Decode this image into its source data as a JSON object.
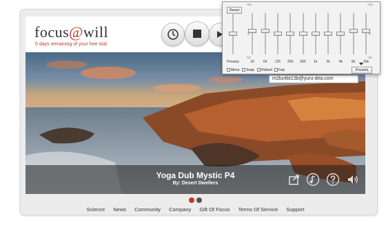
{
  "header": {
    "logo_text": "focus@will",
    "logo_part1": "focus",
    "logo_at": "@",
    "logo_part2": "will",
    "trial_notice": "5 days remaining of your free trial"
  },
  "player": {
    "track_title": "Yoga Dub Mystic P4",
    "artist_line": "By: Desert Dwellers",
    "controls": [
      "share-icon",
      "music-note-icon",
      "help-icon",
      "volume-icon"
    ],
    "top_buttons": [
      "timer-icon",
      "stop-icon",
      "next-icon"
    ]
  },
  "account": {
    "email_fragment": "m2bz4bt13b@yuru-dea.com"
  },
  "carousel": {
    "dot_colors": [
      "#c0392b",
      "#555555"
    ]
  },
  "footer": {
    "links": [
      "Science",
      "News",
      "Community",
      "Company",
      "Gift Of Focus",
      "Terms Of Service",
      "Support"
    ]
  },
  "equalizer": {
    "reset_label": "Reset",
    "scale_top": "+12",
    "scale_zero": "0",
    "scale_bottom": "-12",
    "bands": [
      {
        "label": "Preamp",
        "level": 0
      },
      {
        "label": "32",
        "level": 2
      },
      {
        "label": "64",
        "level": 2
      },
      {
        "label": "125",
        "level": 0
      },
      {
        "label": "250",
        "level": 0
      },
      {
        "label": "500",
        "level": 0
      },
      {
        "label": "1k",
        "level": 0
      },
      {
        "label": "2k",
        "level": 0
      },
      {
        "label": "4k",
        "level": 0
      },
      {
        "label": "8k",
        "level": 2
      },
      {
        "label": "16k",
        "level": 2
      }
    ],
    "checkboxes": [
      "Mono",
      "Snap",
      "Robust",
      "Faq"
    ],
    "presets_label": "Presets"
  }
}
